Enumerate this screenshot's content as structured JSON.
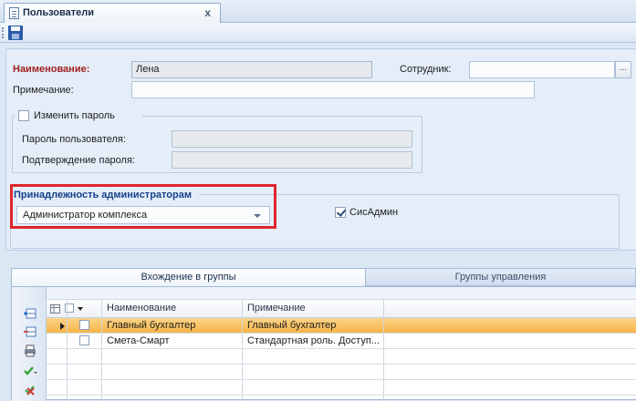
{
  "window": {
    "tab_title": "Пользователи",
    "close_glyph": "x"
  },
  "toolbar": {
    "save_icon": "save-icon"
  },
  "form": {
    "name_label": "Наименование:",
    "name_value": "Лена",
    "employee_label": "Сотрудник:",
    "employee_value": "",
    "ellipsis": "...",
    "note_label": "Примечание:",
    "note_value": "",
    "change_password_label": "Изменить пароль",
    "change_password_checked": false,
    "password_label": "Пароль пользователя:",
    "password_value": "",
    "confirm_label": "Подтверждение пароля:",
    "confirm_value": ""
  },
  "admin": {
    "title": "Принадлежность администраторам",
    "selected": "Администратор комплекса",
    "sysadmin_label": "СисАдмин",
    "sysadmin_checked": true,
    "highlight_color": "#e0262c"
  },
  "tabs": [
    {
      "label": "Вхождение в группы",
      "active": true
    },
    {
      "label": "Группы управления",
      "active": false
    }
  ],
  "grid": {
    "columns": [
      "Наименование",
      "Примечание"
    ],
    "rows": [
      {
        "name": "Главный бухгалтер",
        "note": "Главный бухгалтер",
        "selected": true
      },
      {
        "name": "Смета-Смарт",
        "note": "Стандартная роль. Доступ...",
        "selected": false
      }
    ],
    "selection_color": "#f6b445",
    "side_icons": [
      "add-row-icon",
      "remove-row-icon",
      "print-icon",
      "approve-icon",
      "reject-icon"
    ]
  }
}
